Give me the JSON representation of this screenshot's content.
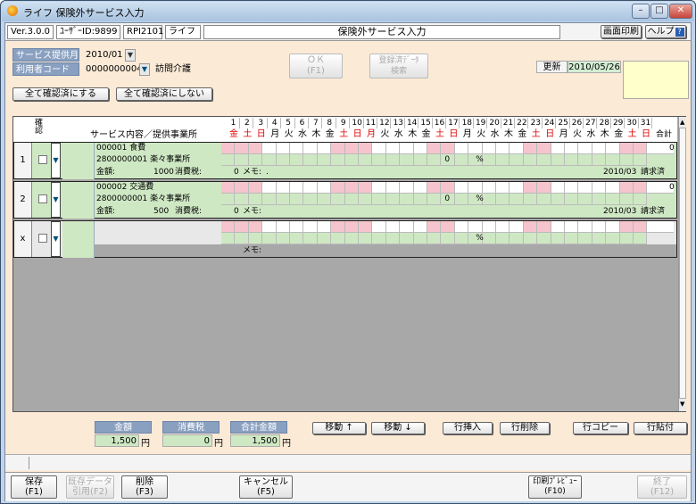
{
  "window": {
    "title": "ライフ 保険外サービス入力",
    "min": "–",
    "max": "□",
    "close": "✕"
  },
  "header": {
    "version": "Ver.3.0.0",
    "user_id": "ﾕｰｻﾞｰID:9899",
    "form_id": "RPI2101",
    "app": "ライフ",
    "screen_title": "保険外サービス入力",
    "print_label": "画面印刷",
    "help_label": "ヘルプ",
    "help_icon": "?"
  },
  "form": {
    "service_month_label": "サービス提供月",
    "service_month_value": "2010/01",
    "user_code_label": "利用者コード",
    "user_code_value": "0000000004",
    "care_type": "訪問介護",
    "ok_label": "ＯＫ",
    "ok_key": "(F1)",
    "registered_label": "登録済ﾃﾞｰﾀ",
    "registered_sub": "検索",
    "updated_label": "更新",
    "updated_value": "2010/05/26"
  },
  "buttons": {
    "confirm_all": "全て確認済にする",
    "unconfirm_all": "全て確認済にしない"
  },
  "grid": {
    "confirm_header_1": "確",
    "confirm_header_2": "認",
    "desc_header": "サービス内容／提供事業所",
    "total_header": "合計",
    "days": [
      "1",
      "2",
      "3",
      "4",
      "5",
      "6",
      "7",
      "8",
      "9",
      "10",
      "11",
      "12",
      "13",
      "14",
      "15",
      "16",
      "17",
      "18",
      "19",
      "20",
      "21",
      "22",
      "23",
      "24",
      "25",
      "26",
      "27",
      "28",
      "29",
      "30",
      "31"
    ],
    "weekdays": [
      "金",
      "土",
      "日",
      "月",
      "火",
      "水",
      "木",
      "金",
      "土",
      "日",
      "月",
      "火",
      "水",
      "木",
      "金",
      "土",
      "日",
      "月",
      "火",
      "水",
      "木",
      "金",
      "土",
      "日",
      "月",
      "火",
      "水",
      "木",
      "金",
      "土",
      "日"
    ],
    "weekday_colors": [
      "#d00",
      "#d00",
      "#d00",
      "#000",
      "#000",
      "#000",
      "#000",
      "#000",
      "#d00",
      "#d00",
      "#d00",
      "#000",
      "#000",
      "#000",
      "#000",
      "#d00",
      "#d00",
      "#000",
      "#000",
      "#000",
      "#000",
      "#000",
      "#d00",
      "#d00",
      "#000",
      "#000",
      "#000",
      "#000",
      "#000",
      "#d00",
      "#d00"
    ],
    "rows": [
      {
        "no": "1",
        "service": "000001 食費",
        "provider": "2800000001 楽々事業所",
        "amount_label": "金額:",
        "amount": "1000",
        "tax_label": "消費税:",
        "tax": "0",
        "memo_label": "メモ:",
        "memo": ".",
        "total": "0",
        "count": "0",
        "percent": "%",
        "month": "2010/03",
        "status": "請求済"
      },
      {
        "no": "2",
        "service": "000002 交通費",
        "provider": "2800000001 楽々事業所",
        "amount_label": "金額:",
        "amount": "500",
        "tax_label": "消費税:",
        "tax": "0",
        "memo_label": "メモ:",
        "memo": "",
        "total": "0",
        "count": "0",
        "percent": "%",
        "month": "2010/03",
        "status": "請求済"
      },
      {
        "no": "x",
        "percent": "%",
        "memo_label": "メモ:"
      }
    ]
  },
  "summary": {
    "amount_label": "金額",
    "amount": "1,500",
    "yen": "円",
    "tax_label": "消費税",
    "tax": "0",
    "total_label": "合計金額",
    "total": "1,500"
  },
  "row_buttons": {
    "move_up": "移動 ↑",
    "move_down": "移動 ↓",
    "insert": "行挿入",
    "delete": "行削除",
    "copy": "行コピー",
    "paste": "行貼付"
  },
  "footer": {
    "save": "保存",
    "save_key": "(F1)",
    "import": "既存データ",
    "import_sub": "引用(F2)",
    "del": "削除",
    "del_key": "(F3)",
    "cancel": "キャンセル",
    "cancel_key": "(F5)",
    "preview": "印刷ﾌﾟﾚﾋﾞｭｰ",
    "preview_key": "(F10)",
    "exit": "終了",
    "exit_key": "(F12)"
  }
}
